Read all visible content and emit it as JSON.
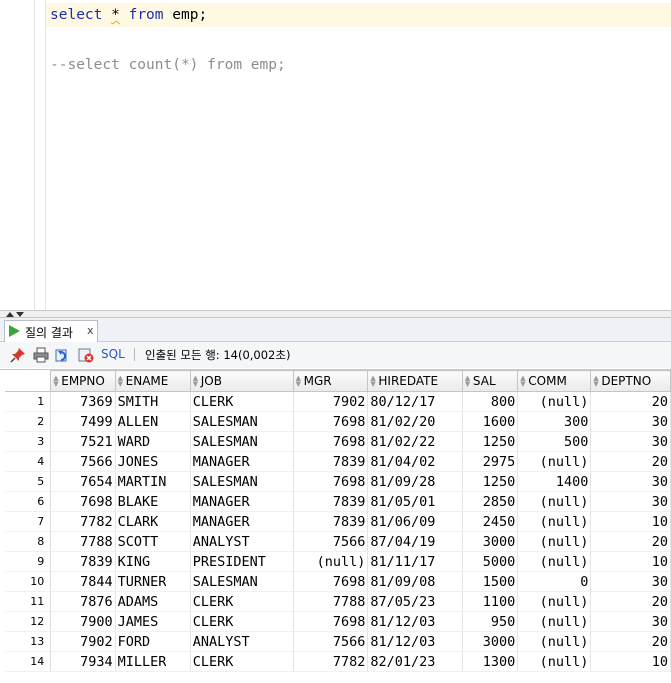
{
  "editor": {
    "line1": {
      "kw1": "select",
      "star": "*",
      "kw2": "from",
      "rest": "emp;"
    },
    "line2": "--select count(*) from emp;"
  },
  "results_tab": {
    "label": "질의 결과",
    "close": "x"
  },
  "toolbar": {
    "icons": [
      "pin-icon",
      "print-icon",
      "refresh-icon",
      "cancel-icon"
    ],
    "sql_label": "SQL",
    "status": "인출된 모든 행: 14(0,002초)"
  },
  "colors": {
    "keyword": "#1d2fa8",
    "comment": "#8d8d8d",
    "current_line": "#fff9e3",
    "sql_link": "#2a56c6"
  },
  "grid": {
    "columns": [
      "EMPNO",
      "ENAME",
      "JOB",
      "MGR",
      "HIREDATE",
      "SAL",
      "COMM",
      "DEPTNO"
    ],
    "rows": [
      [
        "1",
        "7369",
        "SMITH",
        "CLERK",
        "7902",
        "80/12/17",
        "800",
        "(null)",
        "20"
      ],
      [
        "2",
        "7499",
        "ALLEN",
        "SALESMAN",
        "7698",
        "81/02/20",
        "1600",
        "300",
        "30"
      ],
      [
        "3",
        "7521",
        "WARD",
        "SALESMAN",
        "7698",
        "81/02/22",
        "1250",
        "500",
        "30"
      ],
      [
        "4",
        "7566",
        "JONES",
        "MANAGER",
        "7839",
        "81/04/02",
        "2975",
        "(null)",
        "20"
      ],
      [
        "5",
        "7654",
        "MARTIN",
        "SALESMAN",
        "7698",
        "81/09/28",
        "1250",
        "1400",
        "30"
      ],
      [
        "6",
        "7698",
        "BLAKE",
        "MANAGER",
        "7839",
        "81/05/01",
        "2850",
        "(null)",
        "30"
      ],
      [
        "7",
        "7782",
        "CLARK",
        "MANAGER",
        "7839",
        "81/06/09",
        "2450",
        "(null)",
        "10"
      ],
      [
        "8",
        "7788",
        "SCOTT",
        "ANALYST",
        "7566",
        "87/04/19",
        "3000",
        "(null)",
        "20"
      ],
      [
        "9",
        "7839",
        "KING",
        "PRESIDENT",
        "(null)",
        "81/11/17",
        "5000",
        "(null)",
        "10"
      ],
      [
        "10",
        "7844",
        "TURNER",
        "SALESMAN",
        "7698",
        "81/09/08",
        "1500",
        "0",
        "30"
      ],
      [
        "11",
        "7876",
        "ADAMS",
        "CLERK",
        "7788",
        "87/05/23",
        "1100",
        "(null)",
        "20"
      ],
      [
        "12",
        "7900",
        "JAMES",
        "CLERK",
        "7698",
        "81/12/03",
        "950",
        "(null)",
        "30"
      ],
      [
        "13",
        "7902",
        "FORD",
        "ANALYST",
        "7566",
        "81/12/03",
        "3000",
        "(null)",
        "20"
      ],
      [
        "14",
        "7934",
        "MILLER",
        "CLERK",
        "7782",
        "82/01/23",
        "1300",
        "(null)",
        "10"
      ]
    ]
  }
}
